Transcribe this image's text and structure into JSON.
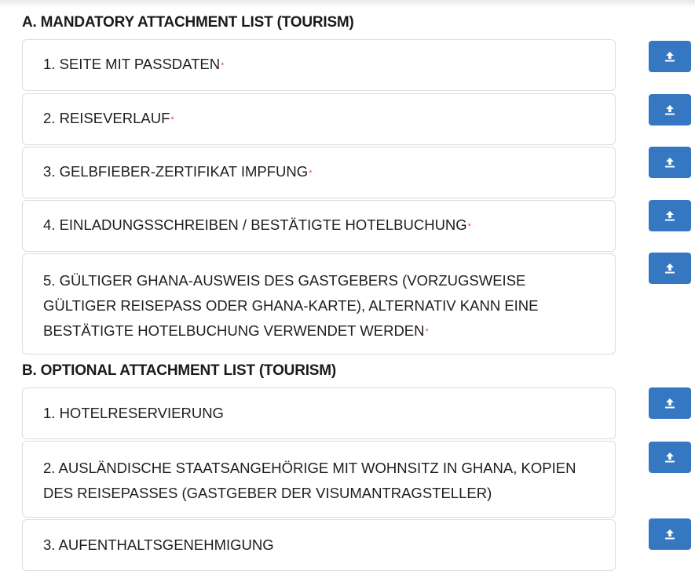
{
  "sections": [
    {
      "title": "A. MANDATORY ATTACHMENT LIST (TOURISM)",
      "items": [
        {
          "label": "1. SEITE MIT PASSDATEN",
          "required_mark": "*"
        },
        {
          "label": "2. REISEVERLAUF",
          "required_mark": "*"
        },
        {
          "label": "3. GELBFIEBER-ZERTIFIKAT IMPFUNG",
          "required_mark": "*"
        },
        {
          "label": "4. EINLADUNGSSCHREIBEN / BESTÄTIGTE HOTELBUCHUNG",
          "required_mark": "*"
        },
        {
          "label": "5. GÜLTIGER GHANA-AUSWEIS DES GASTGEBERS (VORZUGSWEISE GÜLTIGER REISEPASS ODER GHANA-KARTE), ALTERNATIV KANN EINE BESTÄTIGTE HOTELBUCHUNG VERWENDET WERDEN",
          "required_mark": "*"
        }
      ]
    },
    {
      "title": "B. OPTIONAL ATTACHMENT LIST (TOURISM)",
      "items": [
        {
          "label": "1. HOTELRESERVIERUNG"
        },
        {
          "label": "2. AUSLÄNDISCHE STAATSANGEHÖRIGE MIT WOHNSITZ IN GHANA, KOPIEN DES REISEPASSES (GASTGEBER DER VISUMANTRAGSTELLER)"
        },
        {
          "label": "3. AUFENTHALTSGENEHMIGUNG"
        }
      ]
    }
  ],
  "upload_icon": "upload-icon",
  "colors": {
    "upload_button": "#3577c1",
    "required_mark": "#e0524f",
    "card_border": "#dcdcdc"
  }
}
